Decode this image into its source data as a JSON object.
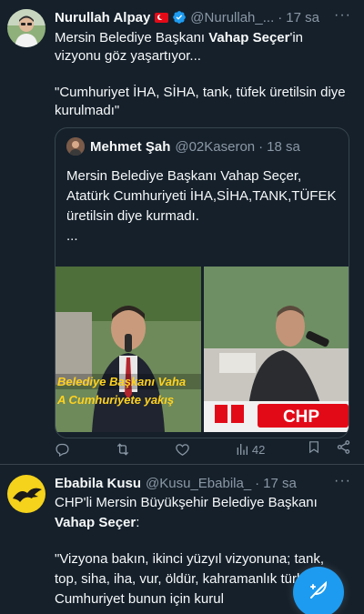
{
  "tweet1": {
    "name": "Nurullah Alpay",
    "handle": "@Nurullah_...",
    "time": "17 sa",
    "text_pre": "Mersin Belediye Başkanı ",
    "text_bold": "Vahap Seçer",
    "text_post": "'in vizyonu göz yaşartıyor...",
    "text_quote": "\"Cumhuriyet İHA, SİHA, tank, tüfek üretilsin diye kurulmadı\"",
    "quoted": {
      "name": "Mehmet Şah",
      "handle": "@02Kaseron",
      "time": "18 sa",
      "text": "Mersin Belediye Başkanı Vahap Seçer, Atatürk Cumhuriyeti İHA,SİHA,TANK,TÜFEK üretilsin diye kurmadı.\n...",
      "media": {
        "caption_line1": "Belediye Başkanı Vaha",
        "caption_line2": "A Cumhuriyete yakış",
        "banner_text": "CHP"
      }
    },
    "actions": {
      "replies": "",
      "retweets": "",
      "likes": "",
      "views": "42"
    }
  },
  "tweet2": {
    "name": "Ebabila Kusu",
    "handle": "@Kusu_Ebabila_",
    "time": "17 sa",
    "text_line1": "CHP'li Mersin Büyükşehir Belediye Başkanı",
    "text_bold": "Vahap Seçer",
    "text_colon": ":",
    "text_quote": "\"Vizyona bakın, ikinci yüzyıl vizyonuna; tank, top, siha, iha, vur, öldür, kahramanlık türküleri. Cumhuriyet bunun için kurul"
  },
  "icons": {
    "more": "more-icon",
    "verified": "verified-badge-icon",
    "reply": "reply-icon",
    "retweet": "retweet-icon",
    "like": "heart-icon",
    "views": "views-icon",
    "bookmark": "bookmark-icon",
    "share": "share-icon",
    "compose": "compose-feather-icon"
  },
  "colors": {
    "background": "#15202b",
    "accent": "#1d9bf0",
    "muted": "#8b98a5",
    "border": "#38444d"
  }
}
